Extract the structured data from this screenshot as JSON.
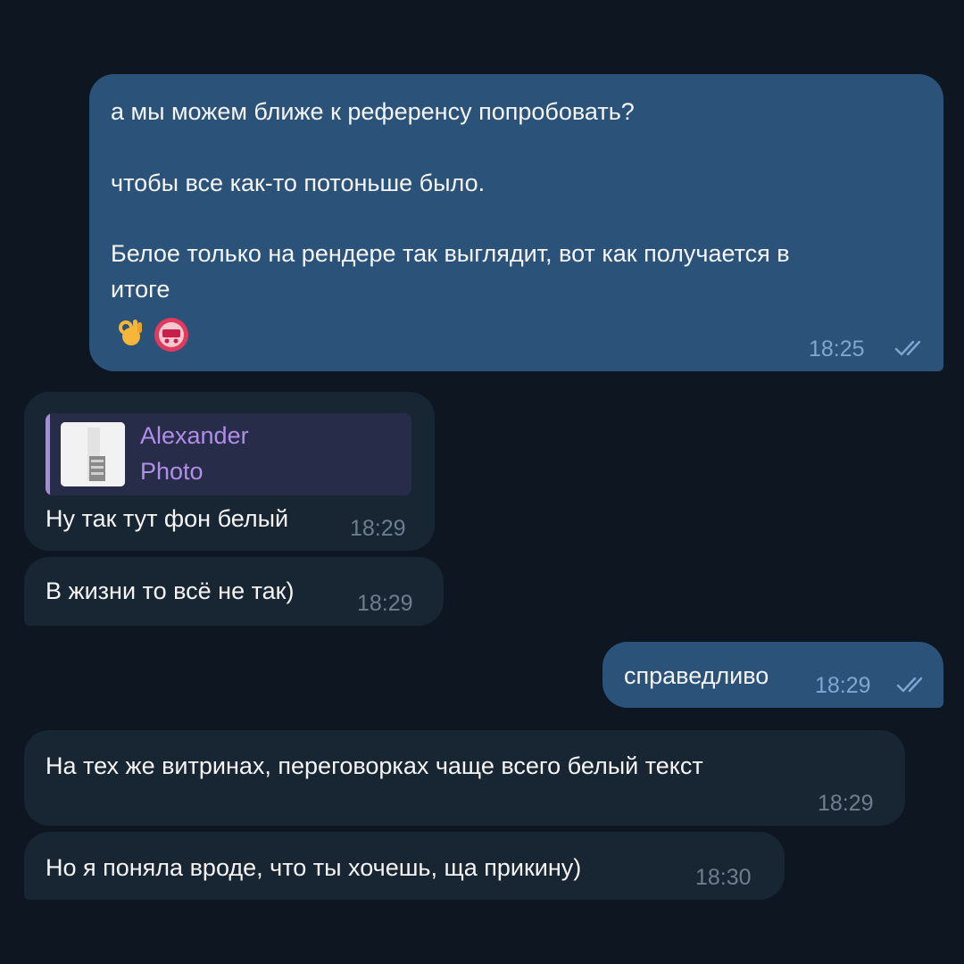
{
  "messages": [
    {
      "direction": "outgoing",
      "paragraphs": [
        "а мы можем ближе к референсу попробовать?",
        "чтобы все как-то потоньше было.",
        "Белое только на рендере так выглядит, вот как получается в\nитоге"
      ],
      "reactions": [
        "ok-hand-emoji",
        "sticker-avatar"
      ],
      "time": "18:25",
      "read": true
    },
    {
      "direction": "incoming",
      "reply": {
        "author": "Alexander",
        "type": "Photo"
      },
      "text": "Ну так тут фон белый",
      "time": "18:29"
    },
    {
      "direction": "incoming",
      "text": "В жизни то всё не так)",
      "time": "18:29"
    },
    {
      "direction": "outgoing",
      "text": "справедливо",
      "time": "18:29",
      "read": true
    },
    {
      "direction": "incoming",
      "text": "На тех же витринах, переговорках чаще всего белый текст",
      "time": "18:29"
    },
    {
      "direction": "incoming",
      "text": "Но я поняла вроде, что ты хочешь, ща прикину)",
      "time": "18:30"
    }
  ],
  "colors": {
    "background": "#0e1621",
    "outgoing_bubble": "#2b5278",
    "incoming_bubble": "#182533",
    "reply_accent": "#a78bdb"
  },
  "icons": [
    "double-check-icon",
    "ok-hand-emoji",
    "sticker-avatar",
    "photo-thumbnail"
  ]
}
